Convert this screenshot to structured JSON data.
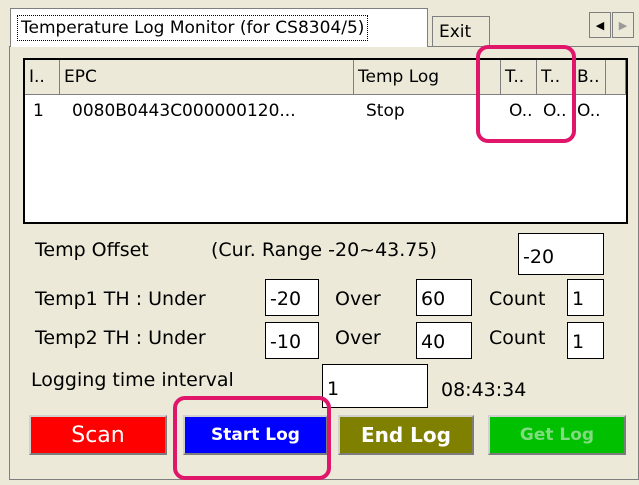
{
  "tabs": [
    {
      "label": "Temperature Log Monitor (for CS8304/5)",
      "selected": true
    },
    {
      "label": "Exit",
      "selected": false
    }
  ],
  "scroll_icons": {
    "left": "triangle-left-icon",
    "right": "triangle-right-icon"
  },
  "list": {
    "columns": [
      "I..",
      "EPC",
      "Temp Log",
      "T..",
      "T..",
      "B.."
    ],
    "rows": [
      {
        "index": "1",
        "epc": "0080B0443C000000120...",
        "temp_log": "Stop",
        "t1": "O..",
        "t2": "O..",
        "b": "O.."
      }
    ]
  },
  "temp_offset": {
    "label": "Temp Offset",
    "range_text": "(Cur. Range -20~43.75)",
    "value": "-20"
  },
  "temp1": {
    "label": "Temp1 TH : Under",
    "under_value": "-20",
    "over_label": "Over",
    "over_value": "60",
    "count_label": "Count",
    "count_value": "1"
  },
  "temp2": {
    "label": "Temp2 TH : Under",
    "under_value": "-10",
    "over_label": "Over",
    "over_value": "40",
    "count_label": "Count",
    "count_value": "1"
  },
  "logging": {
    "label": "Logging time interval",
    "value": "1",
    "time": "08:43:34"
  },
  "buttons": {
    "scan": "Scan",
    "start_log": "Start Log",
    "end_log": "End Log",
    "get_log": "Get Log"
  },
  "colors": {
    "scan": "#ff0000",
    "start_log": "#0000ff",
    "end_log": "#808000",
    "get_log": "#00c000",
    "highlight": "#e0166b"
  }
}
